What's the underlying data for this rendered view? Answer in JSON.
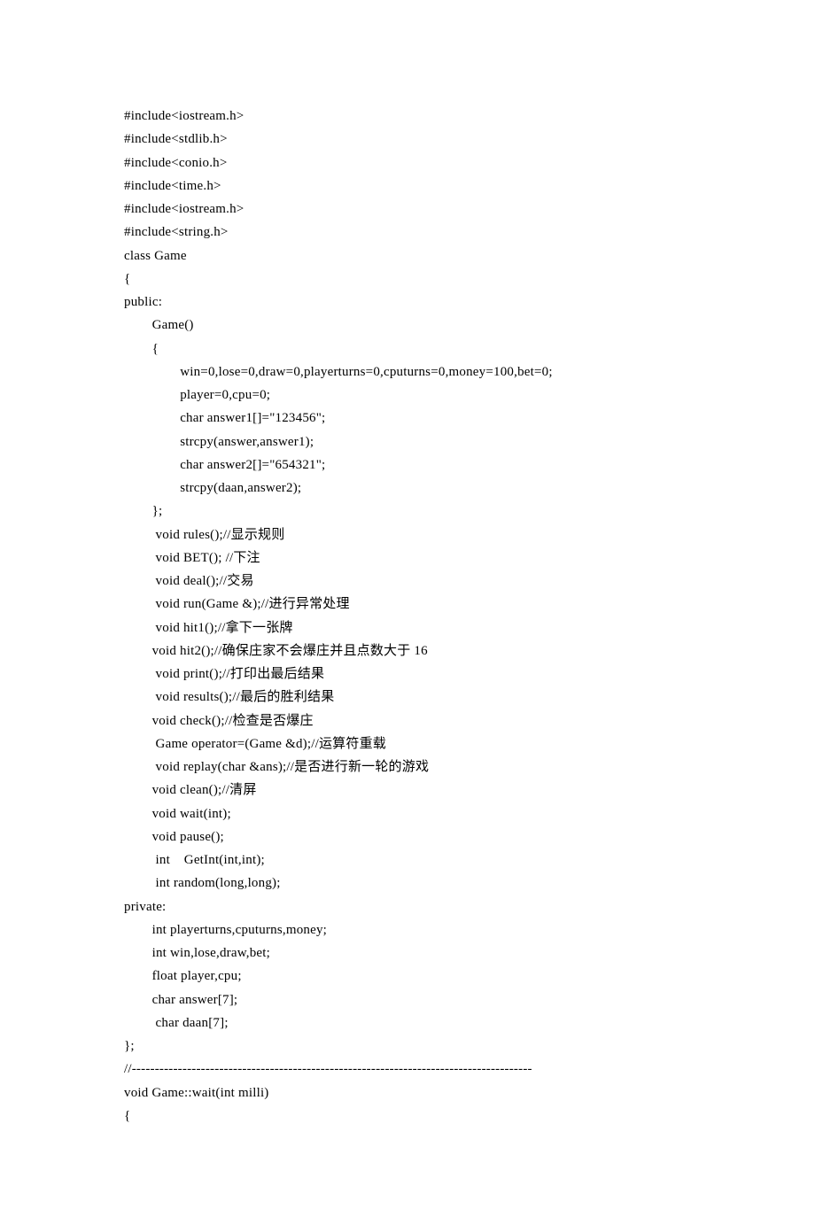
{
  "lines": [
    "#include<iostream.h>",
    "#include<stdlib.h>",
    "#include<conio.h>",
    "#include<time.h>",
    "#include<iostream.h>",
    "#include<string.h>",
    "class Game",
    "{",
    "public:",
    "        Game()",
    "        {",
    "                win=0,lose=0,draw=0,playerturns=0,cputurns=0,money=100,bet=0;",
    "                player=0,cpu=0;",
    "                char answer1[]=\"123456\";",
    "                strcpy(answer,answer1);",
    "                char answer2[]=\"654321\";",
    "                strcpy(daan,answer2);",
    "        };",
    "         void rules();//显示规则",
    "         void BET(); //下注",
    "         void deal();//交易",
    "         void run(Game &);//进行异常处理",
    "         void hit1();//拿下一张牌",
    "        void hit2();//确保庄家不会爆庄并且点数大于 16",
    "         void print();//打印出最后结果",
    "         void results();//最后的胜利结果",
    "        void check();//检查是否爆庄",
    "         Game operator=(Game &d);//运算符重载",
    "         void replay(char &ans);//是否进行新一轮的游戏",
    "        void clean();//清屏",
    "        void wait(int);",
    "        void pause();",
    "         int    GetInt(int,int);",
    "         int random(long,long);",
    "private:",
    "        int playerturns,cputurns,money;",
    "        int win,lose,draw,bet;",
    "        float player,cpu;",
    "        char answer[7];",
    "         char daan[7];",
    "};",
    "//---------------------------------------------------------------------------------------",
    "void Game::wait(int milli)",
    "{"
  ]
}
